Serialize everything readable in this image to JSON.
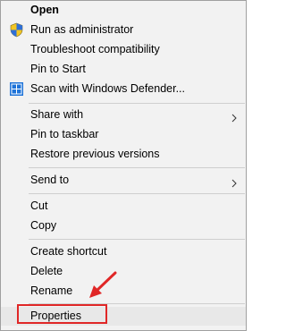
{
  "menu": {
    "items": [
      {
        "label": "Open",
        "bold": true
      },
      {
        "label": "Run as administrator",
        "icon": "shield-icon"
      },
      {
        "label": "Troubleshoot compatibility"
      },
      {
        "label": "Pin to Start"
      },
      {
        "label": "Scan with Windows Defender...",
        "icon": "windows-defender-icon"
      },
      {
        "label": "Share with",
        "submenu": true
      },
      {
        "label": "Pin to taskbar"
      },
      {
        "label": "Restore previous versions"
      },
      {
        "label": "Send to",
        "submenu": true
      },
      {
        "label": "Cut"
      },
      {
        "label": "Copy"
      },
      {
        "label": "Create shortcut"
      },
      {
        "label": "Delete"
      },
      {
        "label": "Rename"
      },
      {
        "label": "Properties",
        "highlighted": true
      }
    ]
  },
  "colors": {
    "menu_background": "#f2f2f2",
    "separator": "#cfcfcf",
    "annotation_red": "#e02727",
    "hover_background": "#e8e8e8"
  }
}
